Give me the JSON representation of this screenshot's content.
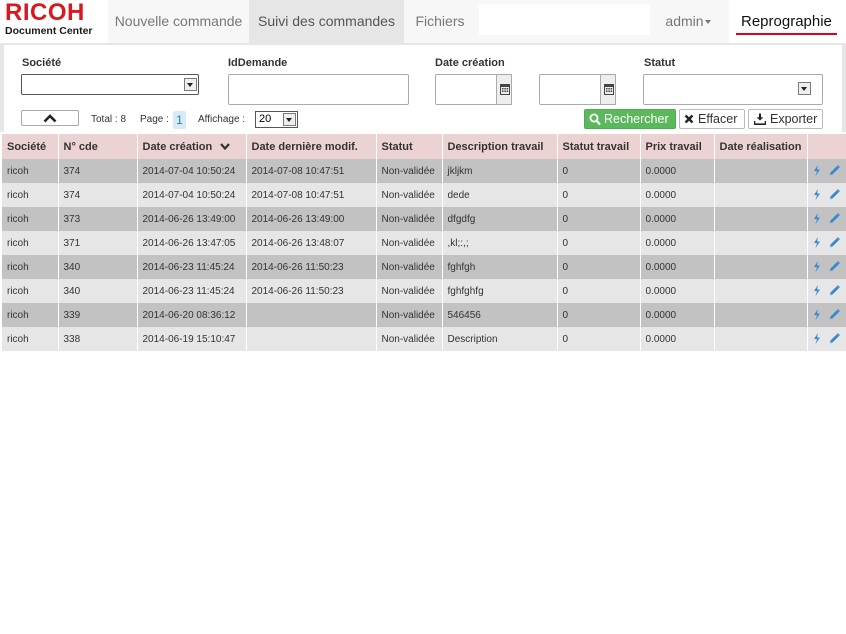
{
  "brand": {
    "line1": "RICOH",
    "line2": "Document Center",
    "product": "Reprographie",
    "accent": "#d51b22"
  },
  "nav": {
    "tabs": [
      {
        "label": "Nouvelle commande",
        "active": false
      },
      {
        "label": "Suivi des commandes",
        "active": true
      },
      {
        "label": "Fichiers",
        "active": false
      }
    ],
    "user": "admin"
  },
  "filters": {
    "societe_label": "Société",
    "idDemande_label": "IdDemande",
    "dateCreation_label": "Date création",
    "statut_label": "Statut",
    "societe_value": "",
    "idDemande_value": "",
    "statut_value": ""
  },
  "pager": {
    "total_label": "Total : 8",
    "page_label": "Page :",
    "page_value": "1",
    "affichage_label": "Affichage :",
    "affichage_value": "20"
  },
  "buttons": {
    "search": "Rechercher",
    "clear": "Effacer",
    "export": "Exporter",
    "search_color": "#5cb85c"
  },
  "table": {
    "headers": [
      "Société",
      "N° cde",
      "Date création",
      "Date dernière modif.",
      "Statut",
      "Description travail",
      "Statut travail",
      "Prix travail",
      "Date réalisation",
      ""
    ],
    "sorted_column": "Date création",
    "header_color": "#ecd3d3",
    "rows": [
      [
        "ricoh",
        "374",
        "2014-07-04 10:50:24",
        "2014-07-08 10:47:51",
        "Non-validée",
        "jkljkm",
        "0",
        "0.0000",
        ""
      ],
      [
        "ricoh",
        "374",
        "2014-07-04 10:50:24",
        "2014-07-08 10:47:51",
        "Non-validée",
        "dede",
        "0",
        "0.0000",
        ""
      ],
      [
        "ricoh",
        "373",
        "2014-06-26 13:49:00",
        "2014-06-26 13:49:00",
        "Non-validée",
        "dfgdfg",
        "0",
        "0.0000",
        ""
      ],
      [
        "ricoh",
        "371",
        "2014-06-26 13:47:05",
        "2014-06-26 13:48:07",
        "Non-validée",
        ",kl;:,;",
        "0",
        "0.0000",
        ""
      ],
      [
        "ricoh",
        "340",
        "2014-06-23 11:45:24",
        "2014-06-26 11:50:23",
        "Non-validée",
        "fghfgh",
        "0",
        "0.0000",
        ""
      ],
      [
        "ricoh",
        "340",
        "2014-06-23 11:45:24",
        "2014-06-26 11:50:23",
        "Non-validée",
        "fghfghfg",
        "0",
        "0.0000",
        ""
      ],
      [
        "ricoh",
        "339",
        "2014-06-20 08:36:12",
        "",
        "Non-validée",
        "546456",
        "0",
        "0.0000",
        ""
      ],
      [
        "ricoh",
        "338",
        "2014-06-19 15:10:47",
        "",
        "Non-validée",
        "Description",
        "0",
        "0.0000",
        ""
      ]
    ],
    "row_actions": [
      "lightning-icon",
      "pencil-icon"
    ]
  }
}
